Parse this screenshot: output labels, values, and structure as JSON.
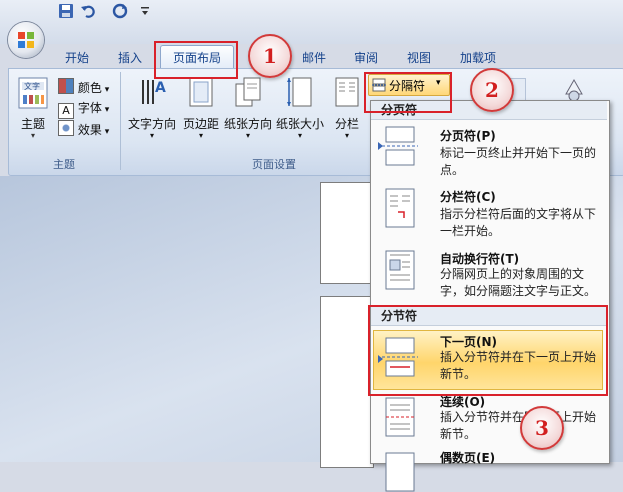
{
  "tabs": [
    "开始",
    "插入",
    "页面布局",
    "邮件",
    "审阅",
    "视图",
    "加载项"
  ],
  "theme_group": {
    "label": "主题",
    "theme_button": "主题",
    "colors": "颜色",
    "fonts": "字体",
    "effects": "效果"
  },
  "page_setup_group": {
    "label": "页面设置",
    "text_direction": "文字方向",
    "margins": "页边距",
    "orientation": "纸张方向",
    "size": "纸张大小",
    "columns": "分栏",
    "breaks": "分隔符"
  },
  "breaks_menu": {
    "page_breaks_header": "分页符",
    "section_breaks_header": "分节符",
    "items": [
      {
        "title": "分页符(P)",
        "desc": "标记一页终止并开始下一页的点。"
      },
      {
        "title": "分栏符(C)",
        "desc": "指示分栏符后面的文字将从下一栏开始。"
      },
      {
        "title": "自动换行符(T)",
        "desc": "分隔网页上的对象周围的文字，如分隔题注文字与正文。"
      },
      {
        "title": "下一页(N)",
        "desc": "插入分节符并在下一页上开始新节。"
      },
      {
        "title": "连续(O)",
        "desc": "插入分节符并在同一页上开始新节。"
      },
      {
        "title": "偶数页(E)",
        "desc": ""
      }
    ]
  },
  "callouts": [
    "1",
    "2",
    "3"
  ],
  "colors": {
    "accent_red": "#d9212a",
    "highlight": "#ffd56b",
    "ribbon_text": "#15428b"
  }
}
